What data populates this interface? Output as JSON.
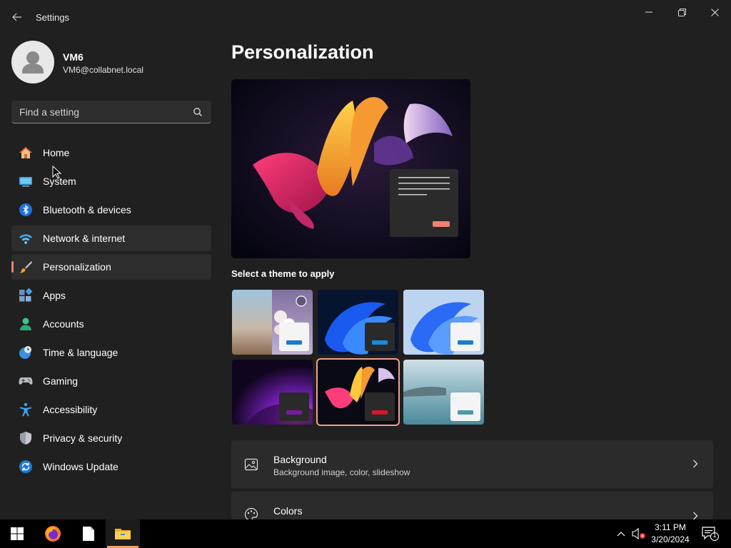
{
  "window": {
    "title": "Settings"
  },
  "profile": {
    "name": "VM6",
    "email": "VM6@collabnet.local"
  },
  "search": {
    "placeholder": "Find a setting"
  },
  "nav": {
    "items": [
      {
        "label": "Home",
        "icon": "home-icon"
      },
      {
        "label": "System",
        "icon": "system-icon"
      },
      {
        "label": "Bluetooth & devices",
        "icon": "bluetooth-icon"
      },
      {
        "label": "Network & internet",
        "icon": "wifi-icon"
      },
      {
        "label": "Personalization",
        "icon": "paintbrush-icon"
      },
      {
        "label": "Apps",
        "icon": "apps-icon"
      },
      {
        "label": "Accounts",
        "icon": "accounts-icon"
      },
      {
        "label": "Time & language",
        "icon": "clock-globe-icon"
      },
      {
        "label": "Gaming",
        "icon": "gamepad-icon"
      },
      {
        "label": "Accessibility",
        "icon": "accessibility-icon"
      },
      {
        "label": "Privacy & security",
        "icon": "shield-icon"
      },
      {
        "label": "Windows Update",
        "icon": "update-icon"
      }
    ],
    "active": "Personalization",
    "hovered": "Network & internet"
  },
  "main": {
    "title": "Personalization",
    "themes_heading": "Select a theme to apply",
    "themes_selected_index": 4,
    "cards": [
      {
        "title": "Background",
        "subtitle": "Background image, color, slideshow",
        "icon": "image-icon"
      },
      {
        "title": "Colors",
        "subtitle": "",
        "icon": "palette-icon"
      }
    ]
  },
  "taskbar": {
    "apps": [
      "start-icon",
      "firefox-icon",
      "file-icon",
      "file-explorer-icon"
    ],
    "time": "3:11 PM",
    "date": "3/20/2024",
    "notification_count": "1"
  },
  "colors": {
    "accent": "#f0816f",
    "background": "#202020",
    "card": "#2b2b2b"
  }
}
